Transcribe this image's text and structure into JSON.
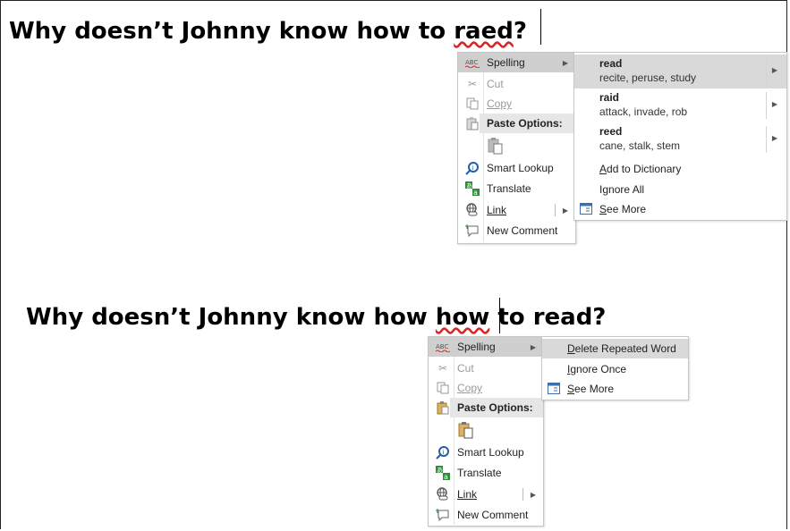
{
  "doc": {
    "line1_pre": "Why doesn’t Johnny know how to ",
    "line1_err": "raed",
    "line1_post": "?",
    "line2_pre": "Why doesn’t Johnny know how ",
    "line2_err": "how",
    "line2_post": " to read?"
  },
  "menu": {
    "spelling": "Spelling",
    "cut": "Cut",
    "copy": "Copy",
    "paste_options": "Paste Options:",
    "smart_lookup": "Smart Lookup",
    "translate": "Translate",
    "link": "Link",
    "new_comment": "New Comment"
  },
  "spelling_sub1": {
    "suggestions": [
      {
        "word": "read",
        "synonyms": "recite, peruse, study"
      },
      {
        "word": "raid",
        "synonyms": "attack, invade, rob"
      },
      {
        "word": "reed",
        "synonyms": "cane, stalk, stem"
      }
    ],
    "add_to_dictionary": "Add to Dictionary",
    "ignore_all": "Ignore All",
    "see_more": "See More"
  },
  "spelling_sub2": {
    "delete_repeated": "Delete Repeated Word",
    "ignore_once": "Ignore Once",
    "see_more": "See More"
  },
  "icons": [
    "spelling-abc-icon",
    "scissors-icon",
    "copy-icon",
    "clipboard-icon",
    "paste-keep-text-icon",
    "smart-lookup-icon",
    "translate-icon",
    "link-icon",
    "new-comment-icon",
    "see-more-icon",
    "chevron-right-icon"
  ],
  "colors": {
    "squiggle": "#d22222",
    "highlight": "#cfcfcf",
    "header_bg": "#e6e6e6"
  }
}
